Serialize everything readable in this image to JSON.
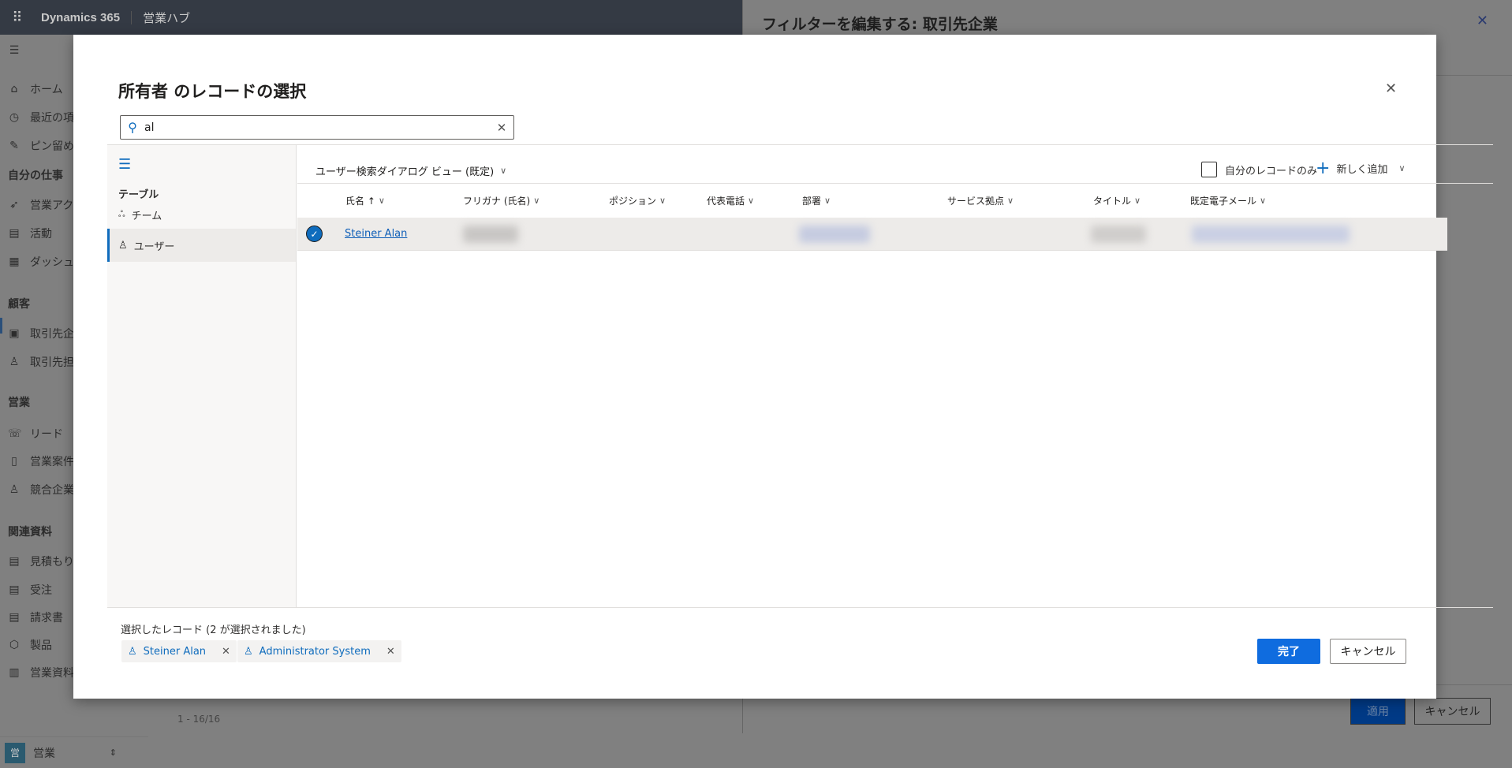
{
  "topbar": {
    "brand": "Dynamics 365",
    "app": "営業ハブ"
  },
  "nav": {
    "items": [
      {
        "label": "ホーム",
        "icon": "home-icon",
        "glyph": "⌂"
      },
      {
        "label": "最近の項目",
        "icon": "clock-icon",
        "glyph": "◷"
      },
      {
        "label": "ピン留め",
        "icon": "pin-icon",
        "glyph": "✎"
      },
      {
        "group": "自分の仕事"
      },
      {
        "label": "営業アクティビティ",
        "icon": "rocket-icon",
        "glyph": "➶"
      },
      {
        "label": "活動",
        "icon": "clipboard-icon",
        "glyph": "▤"
      },
      {
        "label": "ダッシュボード",
        "icon": "dashboard-icon",
        "glyph": "▦"
      },
      {
        "group": "顧客"
      },
      {
        "label": "取引先企業",
        "icon": "account-icon",
        "glyph": "▣"
      },
      {
        "label": "取引先担当者",
        "icon": "contact-icon",
        "glyph": "♙"
      },
      {
        "group": "営業"
      },
      {
        "label": "リード",
        "icon": "phone-icon",
        "glyph": "☏"
      },
      {
        "label": "営業案件",
        "icon": "opportunity-icon",
        "glyph": "▯"
      },
      {
        "label": "競合企業",
        "icon": "competitor-icon",
        "glyph": "♙"
      },
      {
        "group": "関連資料"
      },
      {
        "label": "見積もり",
        "icon": "quote-icon",
        "glyph": "▤"
      },
      {
        "label": "受注",
        "icon": "order-icon",
        "glyph": "▤"
      },
      {
        "label": "請求書",
        "icon": "invoice-icon",
        "glyph": "▤"
      },
      {
        "label": "製品",
        "icon": "product-icon",
        "glyph": "⬡"
      },
      {
        "label": "営業資料",
        "icon": "document-icon",
        "glyph": "▥"
      }
    ],
    "area_badge": "営",
    "area": "営業"
  },
  "pager": "1 - 16/16",
  "filter_panel": {
    "title": "フィルターを編集する: 取引先企業",
    "apply": "適用",
    "cancel": "キャンセル"
  },
  "dialog": {
    "title": "所有者 のレコードの選択",
    "search": {
      "value": "al"
    },
    "tables_heading": "テーブル",
    "tables": [
      {
        "label": "チーム",
        "icon": "team-icon"
      },
      {
        "label": "ユーザー",
        "icon": "user-icon",
        "selected": true
      }
    ],
    "view": "ユーザー検索ダイアログ ビュー (既定)",
    "my_records_only": "自分のレコードのみ",
    "my_records_checked": false,
    "add_new": "新しく追加",
    "columns": [
      "氏名 ↑",
      "フリガナ (氏名)",
      "ポジション",
      "代表電話",
      "部署",
      "サービス拠点",
      "タイトル",
      "既定電子メール"
    ],
    "rows": [
      {
        "name": "Steiner Alan",
        "selected": true
      }
    ],
    "selected_label": "選択したレコード (2 が選択されました)",
    "selected": [
      "Steiner Alan",
      "Administrator System"
    ],
    "done": "完了",
    "cancel": "キャンセル"
  },
  "colors": {
    "accent": "#0f6cbd",
    "primary_button": "#0f6cdf",
    "row_selected": "#edebe9"
  }
}
